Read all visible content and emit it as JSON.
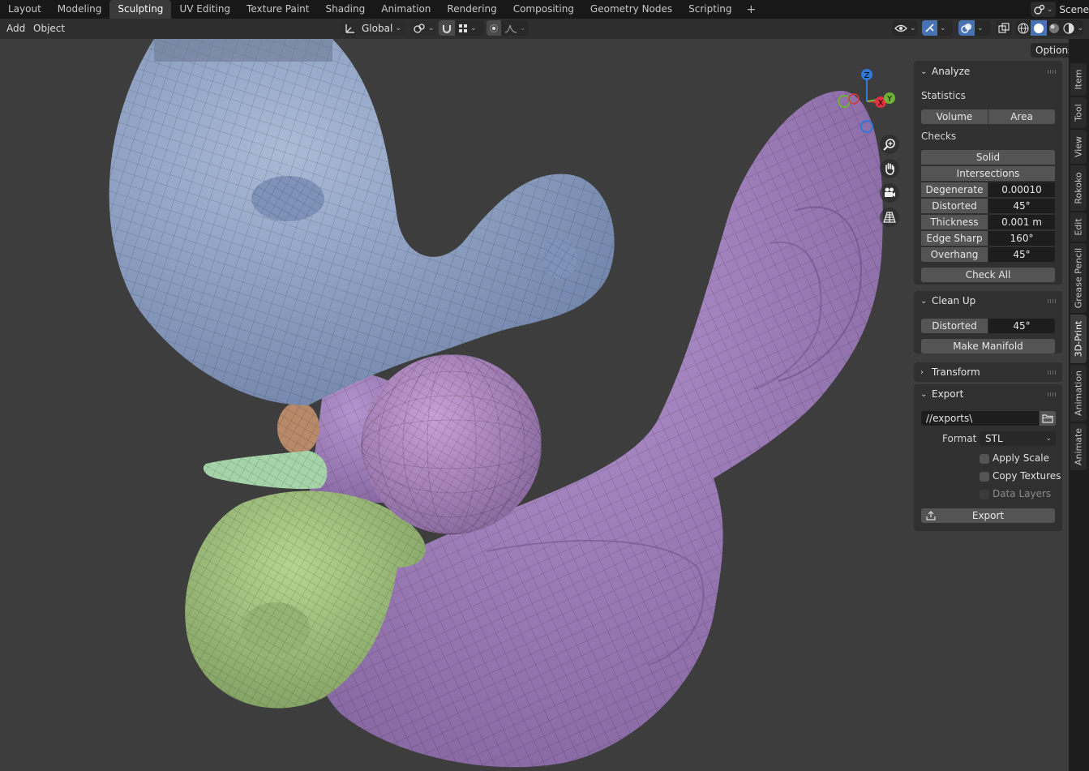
{
  "workspace_tabs": [
    "Layout",
    "Modeling",
    "Sculpting",
    "UV Editing",
    "Texture Paint",
    "Shading",
    "Animation",
    "Rendering",
    "Compositing",
    "Geometry Nodes",
    "Scripting"
  ],
  "active_workspace": "Sculpting",
  "add_tab_symbol": "+",
  "scene_name": "Scene",
  "header": {
    "menu_add": "Add",
    "menu_object": "Object",
    "transform_orientation": "Global",
    "options": "Options"
  },
  "sidebar": {
    "analyze": {
      "title": "Analyze",
      "statistics_label": "Statistics",
      "volume_btn": "Volume",
      "area_btn": "Area",
      "checks_label": "Checks",
      "solid_btn": "Solid",
      "intersections_btn": "Intersections",
      "rows": [
        {
          "label": "Degenerate",
          "value": "0.00010"
        },
        {
          "label": "Distorted",
          "value": "45°"
        },
        {
          "label": "Thickness",
          "value": "0.001 m"
        },
        {
          "label": "Edge Sharp",
          "value": "160°"
        },
        {
          "label": "Overhang",
          "value": "45°"
        }
      ],
      "check_all_btn": "Check All"
    },
    "cleanup": {
      "title": "Clean Up",
      "distorted_label": "Distorted",
      "distorted_value": "45°",
      "make_manifold_btn": "Make Manifold"
    },
    "transform": {
      "title": "Transform"
    },
    "export": {
      "title": "Export",
      "path": "//exports\\",
      "format_label": "Format",
      "format_value": "STL",
      "apply_scale": "Apply Scale",
      "copy_textures": "Copy Textures",
      "data_layers": "Data Layers",
      "export_btn": "Export"
    }
  },
  "right_tabs": [
    "Item",
    "Tool",
    "View",
    "Rokoko",
    "Edit",
    "Grease Pencil",
    "3D-Print",
    "Animation",
    "Animate"
  ],
  "active_right_tab": "3D-Print",
  "gizmo": {
    "z": "Z",
    "x": "X",
    "y": "Y"
  },
  "colors": {
    "viewport_bg": "#3d3d3d",
    "blue_mesh": "#8a9ec4",
    "purple_mesh": "#a383bf",
    "green_mesh": "#9bbf7a",
    "mint_mesh": "#a5d4a9",
    "orange_mesh": "#b88a6a"
  },
  "icons": {
    "zoom": "zoom-icon",
    "pan": "hand-icon",
    "camera": "camera-icon",
    "grid": "ortho-grid-icon"
  }
}
